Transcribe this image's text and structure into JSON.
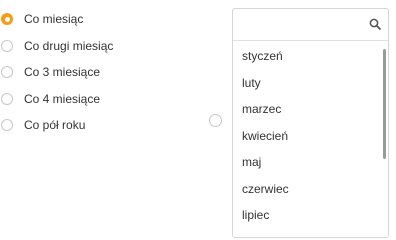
{
  "frequency_options": [
    {
      "label": "Co miesiąc",
      "selected": true
    },
    {
      "label": "Co drugi miesiąc",
      "selected": false
    },
    {
      "label": "Co 3 miesiące",
      "selected": false
    },
    {
      "label": "Co 4 miesiące",
      "selected": false
    },
    {
      "label": "Co pół roku",
      "selected": false
    }
  ],
  "dropdown": {
    "search_placeholder": "",
    "months": [
      "styczeń",
      "luty",
      "marzec",
      "kwiecień",
      "maj",
      "czerwiec",
      "lipiec"
    ]
  },
  "colors": {
    "accent": "#f59b16",
    "radio_border": "#c7c7c7",
    "text": "#333333"
  },
  "icons": {
    "search": "search-icon"
  }
}
